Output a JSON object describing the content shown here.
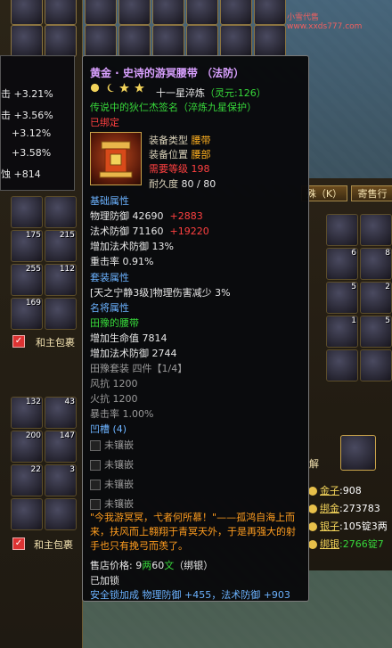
{
  "watermark": "小雪代售www.xxds777.com",
  "tooltip": {
    "title": "黄金 · 史诗的游冥腰带 （法防）",
    "refine": "十一星淬炼",
    "spirit": "（灵元:126）",
    "engraving": "传说中的狄仁杰签名（淬炼九星保护）",
    "bound": "已绑定",
    "equip_type_label": "装备类型",
    "equip_type": "腰带",
    "equip_pos_label": "装备位置",
    "equip_pos": "腰部",
    "req_level_label": "需要等级",
    "req_level": "198",
    "durability_label": "耐久度",
    "durability": "80 / 80",
    "base_header": "基础属性",
    "phys_def_label": "物理防御",
    "phys_def": "42690",
    "phys_def_bonus": "+2883",
    "mag_def_label": "法术防御",
    "mag_def": "71160",
    "mag_def_bonus": "+19220",
    "mag_def_pct": "增加法术防御 13%",
    "crit_rate": "重击率  0.91%",
    "set_header": "套装属性",
    "set_effect": "[天之宁静3级]物理伤害减少 3%",
    "famous_header": "名将属性",
    "famous_name": "田豫的腰带",
    "hp_line": "增加生命值 7814",
    "mag_def_line": "增加法术防御 2744",
    "set_name": "田豫套装  四件【1/4】",
    "wind": "风抗 1200",
    "fire": "火抗 1200",
    "crit_dmg": "暴击率 1.00%",
    "sockets_header": "凹槽 (4)",
    "socket_label": "未镶嵌",
    "description": "\"今我游冥冥，弋者何所慕！\"——孤鸿自海上而来，扶风而上翱翔于青冥天外，于是再强大的射手也只有挽弓而羡了。",
    "price_label": "售店价格:",
    "price_gold": "9",
    "price_unit_gold": "两",
    "price_silver": "60",
    "price_unit_silver": "文",
    "price_bind": "（绑银）",
    "locked": "已加锁",
    "safe_lock": "安全锁加成  物理防御 +455，法术防御 +903"
  },
  "stats": [
    "+3.21%",
    "+3.56%",
    "+3.12%",
    "+3.58%",
    "+814"
  ],
  "stat_prefixes": [
    "击",
    "击",
    "",
    "",
    "蚀"
  ],
  "left_panel": {
    "slot_counts": [
      "175",
      "215",
      "255",
      "112",
      "169",
      "132",
      "43",
      "200",
      "147",
      "22",
      "3"
    ],
    "with_main_pack": "和主包裹"
  },
  "right_panel": {
    "btn_left": "殊（K）",
    "btn_right": "寄售行",
    "slot_counts": [
      "6",
      "8",
      "5",
      "2",
      "1",
      "5"
    ],
    "solve": "解"
  },
  "money": [
    {
      "label": "金子",
      "value": ":908"
    },
    {
      "label": "绑金",
      "value": ":273783"
    },
    {
      "label": "银子",
      "value": ":105锭3两"
    },
    {
      "label": "绑银",
      "value": ":2766锭7"
    }
  ],
  "colors": {
    "title": "#d9a0ff",
    "green": "#37d83a",
    "red": "#ff4040",
    "blue": "#6bb2ff",
    "orange": "#ff9d1f"
  }
}
